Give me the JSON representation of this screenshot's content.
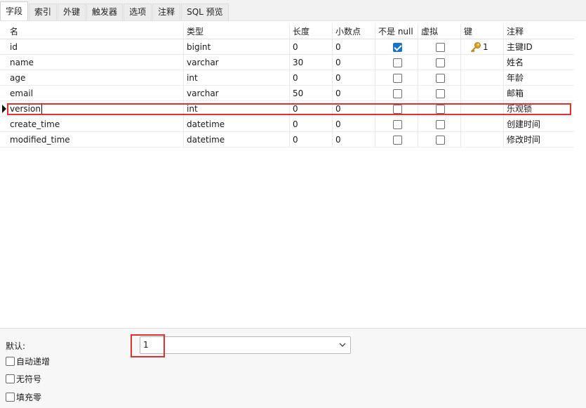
{
  "tabs": [
    "字段",
    "索引",
    "外键",
    "触发器",
    "选项",
    "注释",
    "SQL 预览"
  ],
  "columns": {
    "name": "名",
    "type": "类型",
    "length": "长度",
    "decimals": "小数点",
    "not_null": "不是 null",
    "virtual": "虚拟",
    "key": "键",
    "comment": "注释"
  },
  "rows": [
    {
      "name": "id",
      "type": "bigint",
      "length": "0",
      "decimals": "0",
      "not_null": true,
      "virtual": false,
      "key": "1",
      "comment": "主键ID"
    },
    {
      "name": "name",
      "type": "varchar",
      "length": "30",
      "decimals": "0",
      "not_null": false,
      "virtual": false,
      "key": "",
      "comment": "姓名"
    },
    {
      "name": "age",
      "type": "int",
      "length": "0",
      "decimals": "0",
      "not_null": false,
      "virtual": false,
      "key": "",
      "comment": "年龄"
    },
    {
      "name": "email",
      "type": "varchar",
      "length": "50",
      "decimals": "0",
      "not_null": false,
      "virtual": false,
      "key": "",
      "comment": "邮箱"
    },
    {
      "name": "version",
      "type": "int",
      "length": "0",
      "decimals": "0",
      "not_null": false,
      "virtual": false,
      "key": "",
      "comment": "乐观锁"
    },
    {
      "name": "create_time",
      "type": "datetime",
      "length": "0",
      "decimals": "0",
      "not_null": false,
      "virtual": false,
      "key": "",
      "comment": "创建时间"
    },
    {
      "name": "modified_time",
      "type": "datetime",
      "length": "0",
      "decimals": "0",
      "not_null": false,
      "virtual": false,
      "key": "",
      "comment": "修改时间"
    }
  ],
  "bottom": {
    "default_label": "默认:",
    "default_value": "1",
    "options": [
      "自动递增",
      "无符号",
      "填充零"
    ]
  },
  "colors": {
    "highlight": "#e03030",
    "checkbox_checked": "#1a73c9",
    "key_icon": "#e0a020"
  },
  "icons": {
    "key": "key-icon",
    "row_pointer": "row-indicator-icon",
    "dropdown": "chevron-down-icon"
  }
}
